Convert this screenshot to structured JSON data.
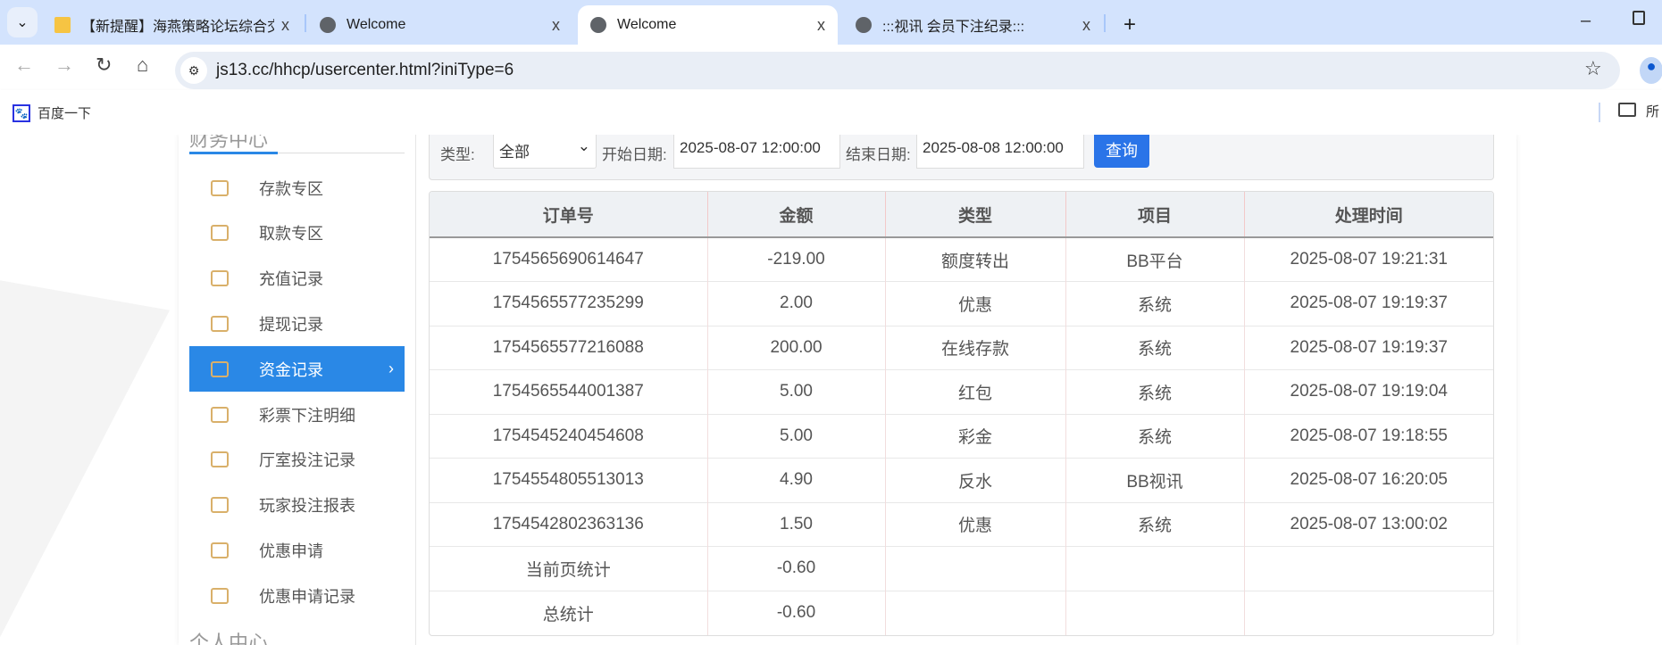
{
  "browser": {
    "tabs": [
      {
        "title": "【新提醒】海燕策略论坛综合交",
        "icon": "notice-icon",
        "active": false
      },
      {
        "title": "Welcome",
        "icon": "globe-icon",
        "active": false
      },
      {
        "title": "Welcome",
        "icon": "globe-icon",
        "active": true
      },
      {
        "title": ":::视讯 会员下注纪录:::",
        "icon": "globe-icon",
        "active": false
      }
    ],
    "new_tab": "+",
    "close": "x",
    "url": "js13.cc/hhcp/usercenter.html?iniType=6",
    "bookmarks": [
      {
        "label": "百度一下",
        "icon": "baidu-paw-icon"
      }
    ],
    "bookmarks_folder": "所"
  },
  "sidebar": {
    "section_title": "财务中心",
    "items": [
      {
        "label": "存款专区",
        "icon": "deposit-card-icon"
      },
      {
        "label": "取款专区",
        "icon": "withdraw-hand-icon"
      },
      {
        "label": "充值记录",
        "icon": "money-bag-icon"
      },
      {
        "label": "提现记录",
        "icon": "wallet-icon"
      },
      {
        "label": "资金记录",
        "icon": "funds-icon",
        "active": true
      },
      {
        "label": "彩票下注明细",
        "icon": "ticket-list-icon"
      },
      {
        "label": "厅室投注记录",
        "icon": "list-icon"
      },
      {
        "label": "玩家投注报表",
        "icon": "chart-icon"
      },
      {
        "label": "优惠申请",
        "icon": "gift-icon"
      },
      {
        "label": "优惠申请记录",
        "icon": "list-icon"
      }
    ],
    "section2_title": "个人中心"
  },
  "filter": {
    "type_label": "类型:",
    "type_value": "全部",
    "start_label": "开始日期:",
    "start_value": "2025-08-07 12:00:00",
    "end_label": "结束日期:",
    "end_value": "2025-08-08 12:00:00",
    "query_label": "查询"
  },
  "table": {
    "headers": [
      "订单号",
      "金额",
      "类型",
      "项目",
      "处理时间"
    ],
    "rows": [
      [
        "1754565690614647",
        "-219.00",
        "额度转出",
        "BB平台",
        "2025-08-07 19:21:31"
      ],
      [
        "1754565577235299",
        "2.00",
        "优惠",
        "系统",
        "2025-08-07 19:19:37"
      ],
      [
        "1754565577216088",
        "200.00",
        "在线存款",
        "系统",
        "2025-08-07 19:19:37"
      ],
      [
        "1754565544001387",
        "5.00",
        "红包",
        "系统",
        "2025-08-07 19:19:04"
      ],
      [
        "1754545240454608",
        "5.00",
        "彩金",
        "系统",
        "2025-08-07 19:18:55"
      ],
      [
        "1754554805513013",
        "4.90",
        "反水",
        "BB视讯",
        "2025-08-07 16:20:05"
      ],
      [
        "1754542802363136",
        "1.50",
        "优惠",
        "系统",
        "2025-08-07 13:00:02"
      ]
    ],
    "page_total_label": "当前页统计",
    "page_total_value": "-0.60",
    "grand_total_label": "总统计",
    "grand_total_value": "-0.60"
  },
  "colors": {
    "accent": "#2a88e6",
    "button": "#2a74e8",
    "icon": "#d9b06a",
    "tabbar": "#d3e3fd"
  }
}
